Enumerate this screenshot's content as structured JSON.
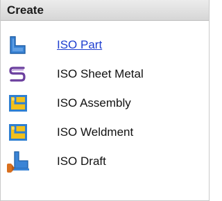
{
  "panel": {
    "title": "Create"
  },
  "items": [
    {
      "label": "ISO Part",
      "icon": "part-icon",
      "is_link": true,
      "link_color": "#1f3fd0"
    },
    {
      "label": "ISO Sheet Metal",
      "icon": "sheet-metal-icon"
    },
    {
      "label": "ISO Assembly",
      "icon": "assembly-icon"
    },
    {
      "label": "ISO Weldment",
      "icon": "weldment-icon"
    },
    {
      "label": "ISO Draft",
      "icon": "draft-icon"
    }
  ],
  "colors": {
    "header_bg": "#dcdcdc",
    "part_blue": "#3a84d6",
    "sheet_metal_purple": "#6b3f9e",
    "assembly_yellow": "#f2c01a",
    "assembly_frame": "#2f7fd1",
    "draft_orange": "#d9701e"
  }
}
